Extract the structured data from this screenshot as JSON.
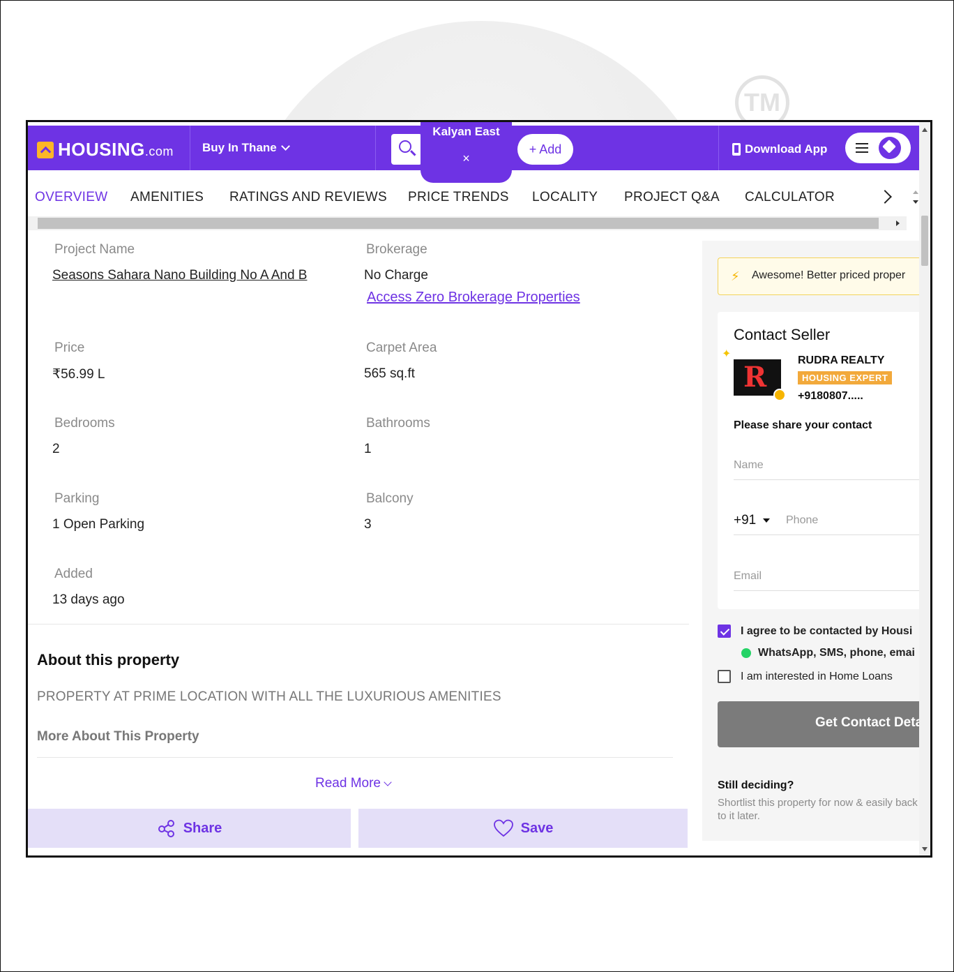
{
  "brand": {
    "name": "HOUSING",
    "suffix": ".com",
    "primary": "#6e33e4",
    "accent": "#fcb627"
  },
  "header": {
    "city_selector": "Buy In Thane",
    "location_chip": "Kalyan East",
    "location_remove": "×",
    "add_label": "+ Add",
    "download_app": "Download App"
  },
  "tabs": [
    "OVERVIEW",
    "AMENITIES",
    "RATINGS AND REVIEWS",
    "PRICE TRENDS",
    "LOCALITY",
    "PROJECT Q&A",
    "CALCULATOR"
  ],
  "details": {
    "project_name": {
      "label": "Project Name",
      "value": "Seasons Sahara Nano Building No A And B"
    },
    "brokerage": {
      "label": "Brokerage",
      "value": "No Charge",
      "link": "Access Zero Brokerage Properties"
    },
    "price": {
      "label": "Price",
      "value": "₹56.99 L"
    },
    "carpet_area": {
      "label": "Carpet Area",
      "value": "565 sq.ft"
    },
    "bedrooms": {
      "label": "Bedrooms",
      "value": "2"
    },
    "bathrooms": {
      "label": "Bathrooms",
      "value": "1"
    },
    "parking": {
      "label": "Parking",
      "value": "1 Open Parking"
    },
    "balcony": {
      "label": "Balcony",
      "value": "3"
    },
    "added": {
      "label": "Added",
      "value": "13 days ago"
    }
  },
  "about": {
    "title": "About this property",
    "description": "PROPERTY AT PRIME LOCATION WITH ALL THE LUXURIOUS AMENITIES",
    "more_title": "More About This Property",
    "read_more": "Read More"
  },
  "actions": {
    "share": "Share",
    "save": "Save"
  },
  "sidebar": {
    "banner": "Awesome! Better priced proper",
    "contact_title": "Contact Seller",
    "seller_name": "RUDRA REALTY",
    "seller_tag": "HOUSING EXPERT",
    "seller_phone": "+9180807.....",
    "seller_logo_text": "R",
    "share_prompt": "Please share your contact",
    "name_placeholder": "Name",
    "country_code": "+91",
    "phone_placeholder": "Phone",
    "email_placeholder": "Email",
    "agree_text": "I agree to be contacted by Housi",
    "agree_channels": "WhatsApp, SMS, phone, emai",
    "home_loans": "I am interested in Home Loans",
    "get_contact": "Get Contact Deta",
    "still_deciding": "Still deciding?",
    "still_sub": "Shortlist this property for now & easily back to it later."
  },
  "watermark": "TM"
}
